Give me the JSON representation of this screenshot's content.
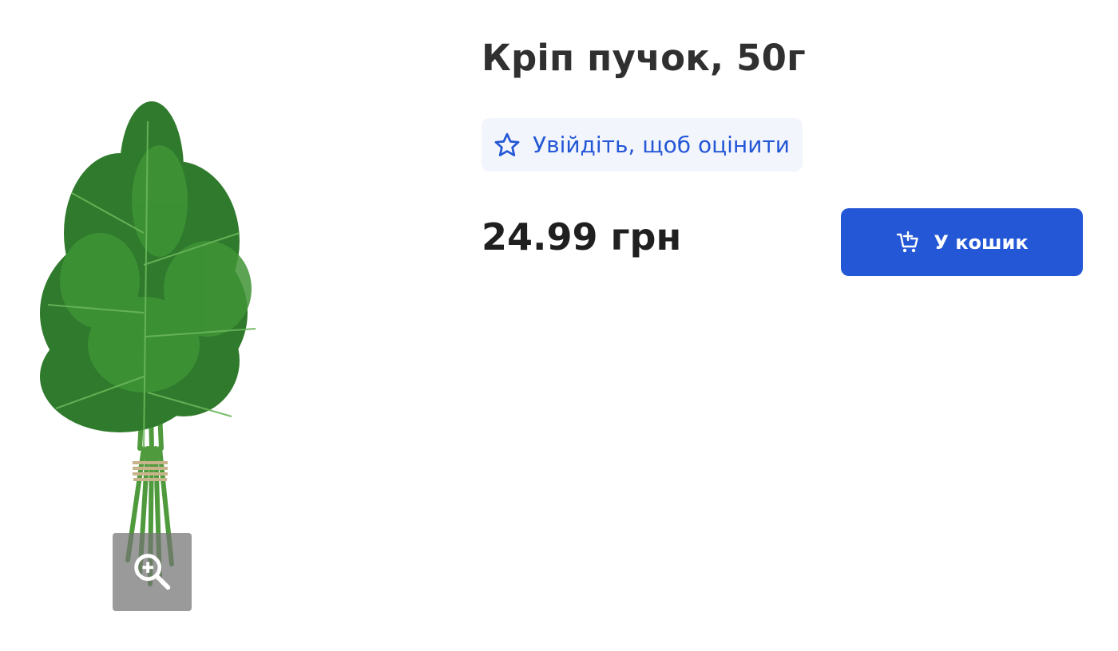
{
  "product": {
    "title": "Кріп пучок, 50г",
    "price": "24.99 грн",
    "image_alt": "Кріп пучок",
    "image_icon": "dill-bunch-image"
  },
  "rating": {
    "label": "Увійдіть, щоб оцінити",
    "icon": "star-outline-icon"
  },
  "cart": {
    "label": "У кошик",
    "icon": "cart-add-icon"
  },
  "gallery": {
    "zoom_icon": "zoom-in-icon"
  },
  "colors": {
    "accent": "#2357d6",
    "pill_background": "#f3f5fc",
    "title_text": "#303030",
    "dill_green": "#2f7a2c"
  }
}
